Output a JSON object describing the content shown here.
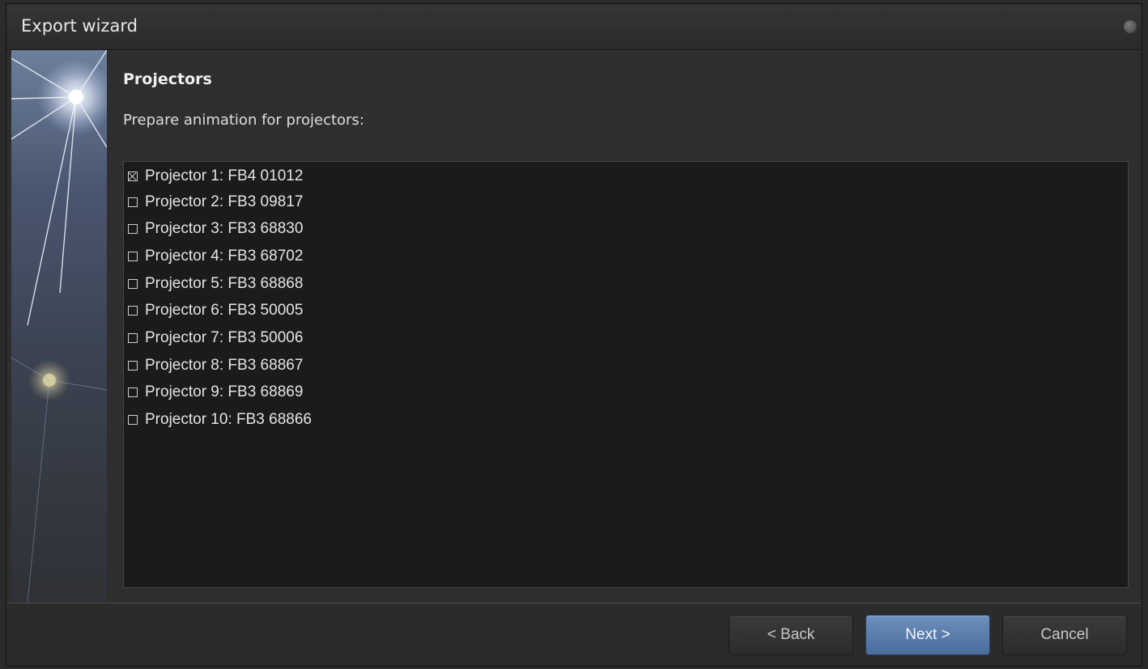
{
  "window": {
    "title": "Export wizard"
  },
  "page": {
    "heading": "Projectors",
    "description": "Prepare animation for projectors:"
  },
  "projectors": [
    {
      "label": "Projector 1: FB4 01012",
      "checked": true
    },
    {
      "label": "Projector 2: FB3 09817",
      "checked": false
    },
    {
      "label": "Projector 3: FB3 68830",
      "checked": false
    },
    {
      "label": "Projector 4: FB3 68702",
      "checked": false
    },
    {
      "label": "Projector 5: FB3 68868",
      "checked": false
    },
    {
      "label": "Projector 6: FB3 50005",
      "checked": false
    },
    {
      "label": "Projector 7: FB3 50006",
      "checked": false
    },
    {
      "label": "Projector 8: FB3 68867",
      "checked": false
    },
    {
      "label": "Projector 9: FB3 68869",
      "checked": false
    },
    {
      "label": "Projector 10: FB3 68866",
      "checked": false
    }
  ],
  "buttons": {
    "back": "< Back",
    "next": "Next >",
    "cancel": "Cancel"
  },
  "colors": {
    "primary_button": "#5a7dab",
    "list_background": "#1b1b1b",
    "window_background": "#2e2e2e"
  }
}
